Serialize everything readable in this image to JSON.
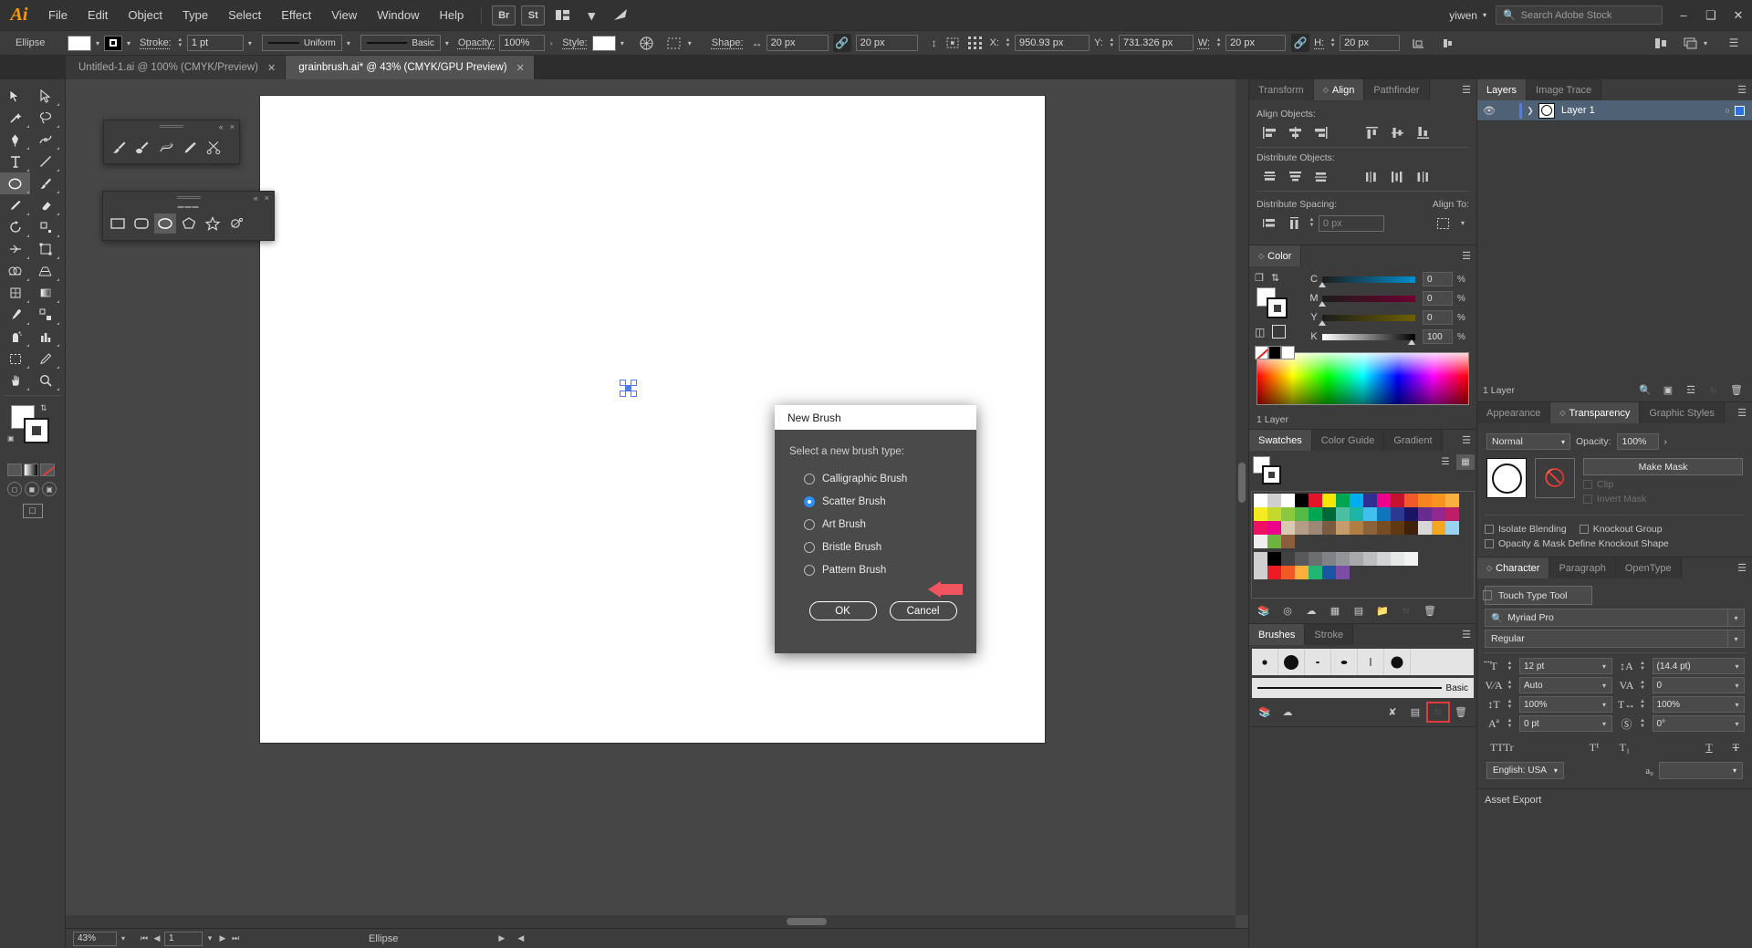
{
  "app": {
    "logo": "Ai",
    "name": "Adobe Illustrator"
  },
  "menubar": {
    "items": [
      "File",
      "Edit",
      "Object",
      "Type",
      "Select",
      "Effect",
      "View",
      "Window",
      "Help"
    ],
    "bridge": "Br",
    "stock": "St",
    "arrange": "arrange-icon",
    "workspace_icon": "essentials-icon",
    "user": "yiwen",
    "search_placeholder": "Search Adobe Stock",
    "win_minimize": "–",
    "win_maximize": "❑",
    "win_close": "✕"
  },
  "controlbar": {
    "object_type": "Ellipse",
    "stroke_label": "Stroke:",
    "stroke_weight": "1 pt",
    "profile_uniform": "Uniform",
    "brush_basic": "Basic",
    "opacity_label": "Opacity:",
    "opacity_value": "100%",
    "style_label": "Style:",
    "shape_label": "Shape:",
    "shape_w": "20 px",
    "shape_h": "20 px",
    "x_label": "X:",
    "x_value": "950.93 px",
    "y_label": "Y:",
    "y_value": "731.326 px",
    "w_label": "W:",
    "w_value": "20 px",
    "h_label": "H:",
    "h_value": "20 px",
    "link_icon": "link-icon",
    "transform_icon": "transform-icon",
    "align_icon": "align-icon",
    "arrange_icon": "arrange-icon",
    "menu_icon": "hamburger-icon"
  },
  "tabs": [
    {
      "label": "Untitled-1.ai @ 100% (CMYK/Preview)",
      "active": false,
      "close": "✕"
    },
    {
      "label": "grainbrush.ai* @ 43% (CMYK/GPU Preview)",
      "active": true,
      "close": "✕"
    }
  ],
  "floating_panels": [
    {
      "name": "brush-tools-flyout",
      "tools": [
        "paintbrush-tool",
        "blob-brush-tool",
        "shaper-tool",
        "pencil-tool",
        "scissors-tool"
      ]
    },
    {
      "name": "shape-tools-flyout",
      "tools": [
        "rectangle-tool",
        "rounded-rectangle-tool",
        "ellipse-tool",
        "polygon-tool",
        "star-tool",
        "flare-tool"
      ],
      "selected_index": 2
    }
  ],
  "statusbar": {
    "zoom": "43%",
    "page": "1",
    "tool": "Ellipse"
  },
  "dialog": {
    "title": "New Brush",
    "prompt": "Select a new brush type:",
    "options": [
      {
        "label": "Calligraphic Brush",
        "selected": false
      },
      {
        "label": "Scatter Brush",
        "selected": true
      },
      {
        "label": "Art Brush",
        "selected": false
      },
      {
        "label": "Bristle Brush",
        "selected": false
      },
      {
        "label": "Pattern Brush",
        "selected": false
      }
    ],
    "ok": "OK",
    "cancel": "Cancel",
    "annotation_arrow_color": "#f0555f"
  },
  "align_panel": {
    "tabs": [
      "Transform",
      "Align",
      "Pathfinder"
    ],
    "active_tab": "Align",
    "align_objects_label": "Align Objects:",
    "distribute_objects_label": "Distribute Objects:",
    "distribute_spacing_label": "Distribute Spacing:",
    "align_to_label": "Align To:",
    "spacing_value": "0 px"
  },
  "color_panel": {
    "tabs": [
      "Color"
    ],
    "mode": "CMYK",
    "channels": [
      {
        "name": "C",
        "value": "0",
        "unit": "%",
        "pct": 0
      },
      {
        "name": "M",
        "value": "0",
        "unit": "%",
        "pct": 0
      },
      {
        "name": "Y",
        "value": "0",
        "unit": "%",
        "pct": 0
      },
      {
        "name": "K",
        "value": "100",
        "unit": "%",
        "pct": 100
      }
    ],
    "layer_count": "1 Layer"
  },
  "swatches_panel": {
    "tabs": [
      "Swatches",
      "Color Guide",
      "Gradient"
    ],
    "active_tab": "Swatches",
    "rows": [
      [
        "#ffffff",
        "#cfcfcf",
        "#ffffff",
        "#000000",
        "#e3132a",
        "#f6e500",
        "#00a551",
        "#00aeef",
        "#2e3192",
        "#ec008c",
        "#c4122f",
        "#f1592a",
        "#f6851f",
        "#f7941e",
        "#fbb040"
      ],
      [
        "#f4ec20",
        "#c4d92e",
        "#8dc63f",
        "#57b947",
        "#00a651",
        "#006838",
        "#4bbea3",
        "#1eb5a6",
        "#41c0f0",
        "#0f75bc",
        "#2b3990",
        "#1b1464",
        "#662d91",
        "#92278f",
        "#be1e68"
      ],
      [
        "#ed1164",
        "#ec008c",
        "#d9c9b0",
        "#b49c87",
        "#9c8874",
        "#7a5c43",
        "#c69c6d",
        "#b07d43",
        "#8c6239",
        "#754c24",
        "#603913",
        "#42210b",
        "#d8d8d8",
        "#f5a623",
        "#9ad3f0"
      ],
      [
        "#efefef",
        "#6db33f",
        "#8b5e3c"
      ],
      [
        "#d0d0d0",
        "#000000",
        "#414042",
        "#58595b",
        "#6d6e71",
        "#808285",
        "#939598",
        "#a7a9ac",
        "#bcbec0",
        "#d1d3d4",
        "#e6e7e8",
        "#f1f2f2"
      ],
      [
        "#d0d0d0",
        "#ed1c24",
        "#f15a24",
        "#fbb03b",
        "#22b573",
        "#1b55a3",
        "#7b4ea3"
      ]
    ],
    "footer_icons": [
      "library-icon",
      "color-group-icon",
      "cloud-icon",
      "show-kind-icon",
      "options-icon",
      "new-group-icon",
      "new-swatch-icon",
      "delete-icon"
    ]
  },
  "brushes_panel": {
    "tabs": [
      "Brushes",
      "Stroke"
    ],
    "active_tab": "Brushes",
    "brushes": [
      "dot-small",
      "dot-large",
      "speck-tiny",
      "blot-small",
      "sliver",
      "dot-round"
    ],
    "basic_label": "Basic",
    "footer_icons": [
      "library-icon",
      "libraries-icon",
      "remove-brushstroke-icon",
      "options-icon",
      "new-brush-icon",
      "delete-brush-icon"
    ],
    "highlighted_footer_icon": "new-brush-icon"
  },
  "layers_panel": {
    "tabs": [
      "Layers",
      "Image Trace"
    ],
    "active_tab": "Layers",
    "layers": [
      {
        "name": "Layer 1",
        "visible": true,
        "selected": true
      }
    ],
    "footer_icons": [
      "locate-object-icon",
      "make-mask-icon",
      "new-sublayer-icon",
      "new-layer-icon",
      "delete-layer-icon"
    ]
  },
  "transparency_panel": {
    "tabs": [
      "Appearance",
      "Transparency",
      "Graphic Styles"
    ],
    "active_tab": "Transparency",
    "blend_mode": "Normal",
    "opacity_label": "Opacity:",
    "opacity_value": "100%",
    "make_mask": "Make Mask",
    "clip": "Clip",
    "invert_mask": "Invert Mask",
    "isolate_blending": "Isolate Blending",
    "knockout_group": "Knockout Group",
    "opacity_mask_define": "Opacity & Mask Define Knockout Shape"
  },
  "character_panel": {
    "tabs": [
      "Character",
      "Paragraph",
      "OpenType"
    ],
    "active_tab": "Character",
    "touch_type_tool": "Touch Type Tool",
    "font_family": "Myriad Pro",
    "font_style": "Regular",
    "font_size": "12 pt",
    "leading": "(14.4 pt)",
    "kerning": "Auto",
    "tracking": "0",
    "vertical_scale": "100%",
    "horizontal_scale": "100%",
    "baseline_shift": "0 pt",
    "rotation": "0°",
    "language": "English: USA",
    "style_buttons": [
      "TT",
      "Tr",
      "T¹",
      "T₁",
      "T-underline",
      "T-strike"
    ]
  },
  "asset_export": {
    "label": "Asset Export"
  },
  "toolbar": {
    "tools": [
      "selection-tool",
      "direct-selection-tool",
      "magic-wand-tool",
      "lasso-tool",
      "pen-tool",
      "curvature-tool",
      "type-tool",
      "line-segment-tool",
      "ellipse-tool",
      "paintbrush-tool",
      "pencil-tool",
      "eraser-tool",
      "rotate-tool",
      "scale-tool",
      "width-tool",
      "free-transform-tool",
      "shape-builder-tool",
      "perspective-grid-tool",
      "mesh-tool",
      "gradient-tool",
      "eyedropper-tool",
      "blend-tool",
      "symbol-sprayer-tool",
      "column-graph-tool",
      "artboard-tool",
      "slice-tool",
      "hand-tool",
      "zoom-tool"
    ],
    "selected_tool": "ellipse-tool",
    "fill_color": "#ffffff",
    "stroke_color": "#ffffff",
    "screen_modes": [
      "normal-screen-mode",
      "full-screen-menu-mode",
      "full-screen-mode"
    ],
    "draw_modes": [
      "draw-normal",
      "draw-behind",
      "draw-inside"
    ]
  }
}
